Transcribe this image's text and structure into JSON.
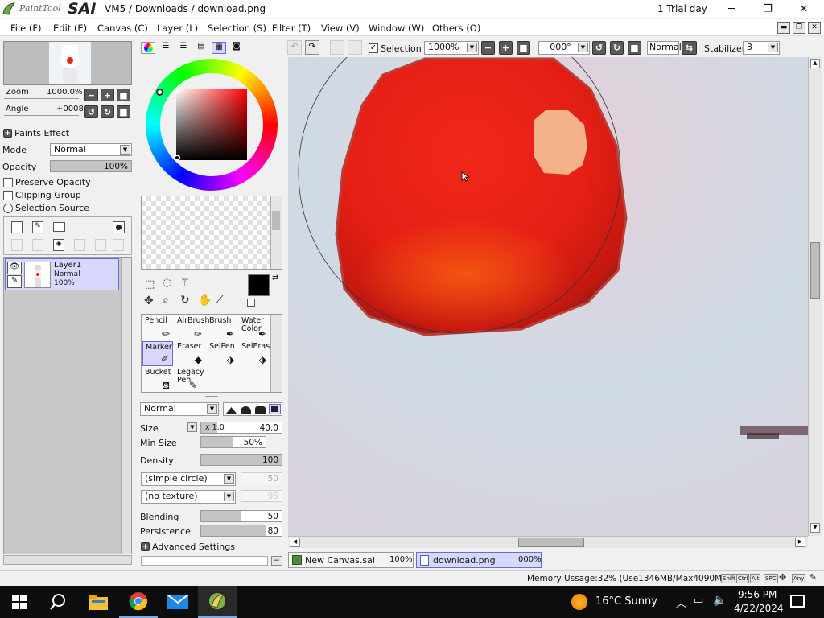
{
  "window": {
    "app_logo_text": "PaintTool",
    "app_logo_sai": "SAI",
    "title": "VM5 / Downloads / download.png",
    "trial": "1 Trial day",
    "controls": {
      "minimize": "─",
      "maximize": "❐",
      "close": "✕"
    }
  },
  "menu": [
    "File (F)",
    "Edit (E)",
    "Canvas (C)",
    "Layer (L)",
    "Selection (S)",
    "Filter (T)",
    "View (V)",
    "Window (W)",
    "Others (O)"
  ],
  "navigator": {
    "zoom_label": "Zoom",
    "zoom_value": "1000.0%",
    "angle_label": "Angle",
    "angle_value": "+0008"
  },
  "layer_props": {
    "paints_effect": "Paints Effect",
    "mode_label": "Mode",
    "mode_value": "Normal",
    "opacity_label": "Opacity",
    "opacity_value": "100%",
    "preserve_opacity": "Preserve Opacity",
    "clipping_group": "Clipping Group",
    "selection_source": "Selection Source"
  },
  "layers": [
    {
      "name": "Layer1",
      "mode": "Normal",
      "opacity": "100%"
    }
  ],
  "tools": [
    {
      "label": "Pencil",
      "icon": "pencil-icon"
    },
    {
      "label": "AirBrush",
      "icon": "airbrush-icon"
    },
    {
      "label": "Brush",
      "icon": "brush-icon"
    },
    {
      "label": "Water Color",
      "icon": "watercolor-icon"
    },
    {
      "label": "Marker",
      "icon": "marker-icon"
    },
    {
      "label": "Eraser",
      "icon": "eraser-icon"
    },
    {
      "label": "SelPen",
      "icon": "selpen-icon"
    },
    {
      "label": "SelEras",
      "icon": "seleras-icon"
    },
    {
      "label": "Bucket",
      "icon": "bucket-icon"
    },
    {
      "label": "Legacy Pen",
      "icon": "legacy-pen-icon"
    }
  ],
  "brush": {
    "blend_mode": "Normal",
    "size_label": "Size",
    "size_mult": "x 1.0",
    "size_value": "40.0",
    "minsize_label": "Min Size",
    "minsize_value": "50%",
    "density_label": "Density",
    "density_value": "100",
    "shape": "(simple circle)",
    "shape_value": "50",
    "texture": "(no texture)",
    "texture_value": "95",
    "blending_label": "Blending",
    "blending_value": "50",
    "persistence_label": "Persistence",
    "persistence_value": "80",
    "advanced": "Advanced Settings"
  },
  "toolbar": {
    "selection_label": "Selection",
    "zoom_value": "1000%",
    "angle_value": "+000°",
    "mode_value": "Normal",
    "stabilizer_label": "Stabilizer",
    "stabilizer_value": "3"
  },
  "doc_tabs": [
    {
      "name": "New Canvas.sai",
      "zoom": "100%"
    },
    {
      "name": "download.png",
      "zoom": "000%"
    }
  ],
  "status": {
    "memory": "Memory Ussage:32% (Use1346MB/Max4090MB)",
    "keys": [
      "Shift",
      "Ctrl",
      "Alt",
      "SPC",
      "Any"
    ]
  },
  "taskbar": {
    "weather": "16°C  Sunny",
    "time": "9:56 PM",
    "date": "4/22/2024"
  },
  "colors": {
    "accent": "#d8d8ff",
    "primary": "#000000",
    "secondary": "#ffffff"
  }
}
